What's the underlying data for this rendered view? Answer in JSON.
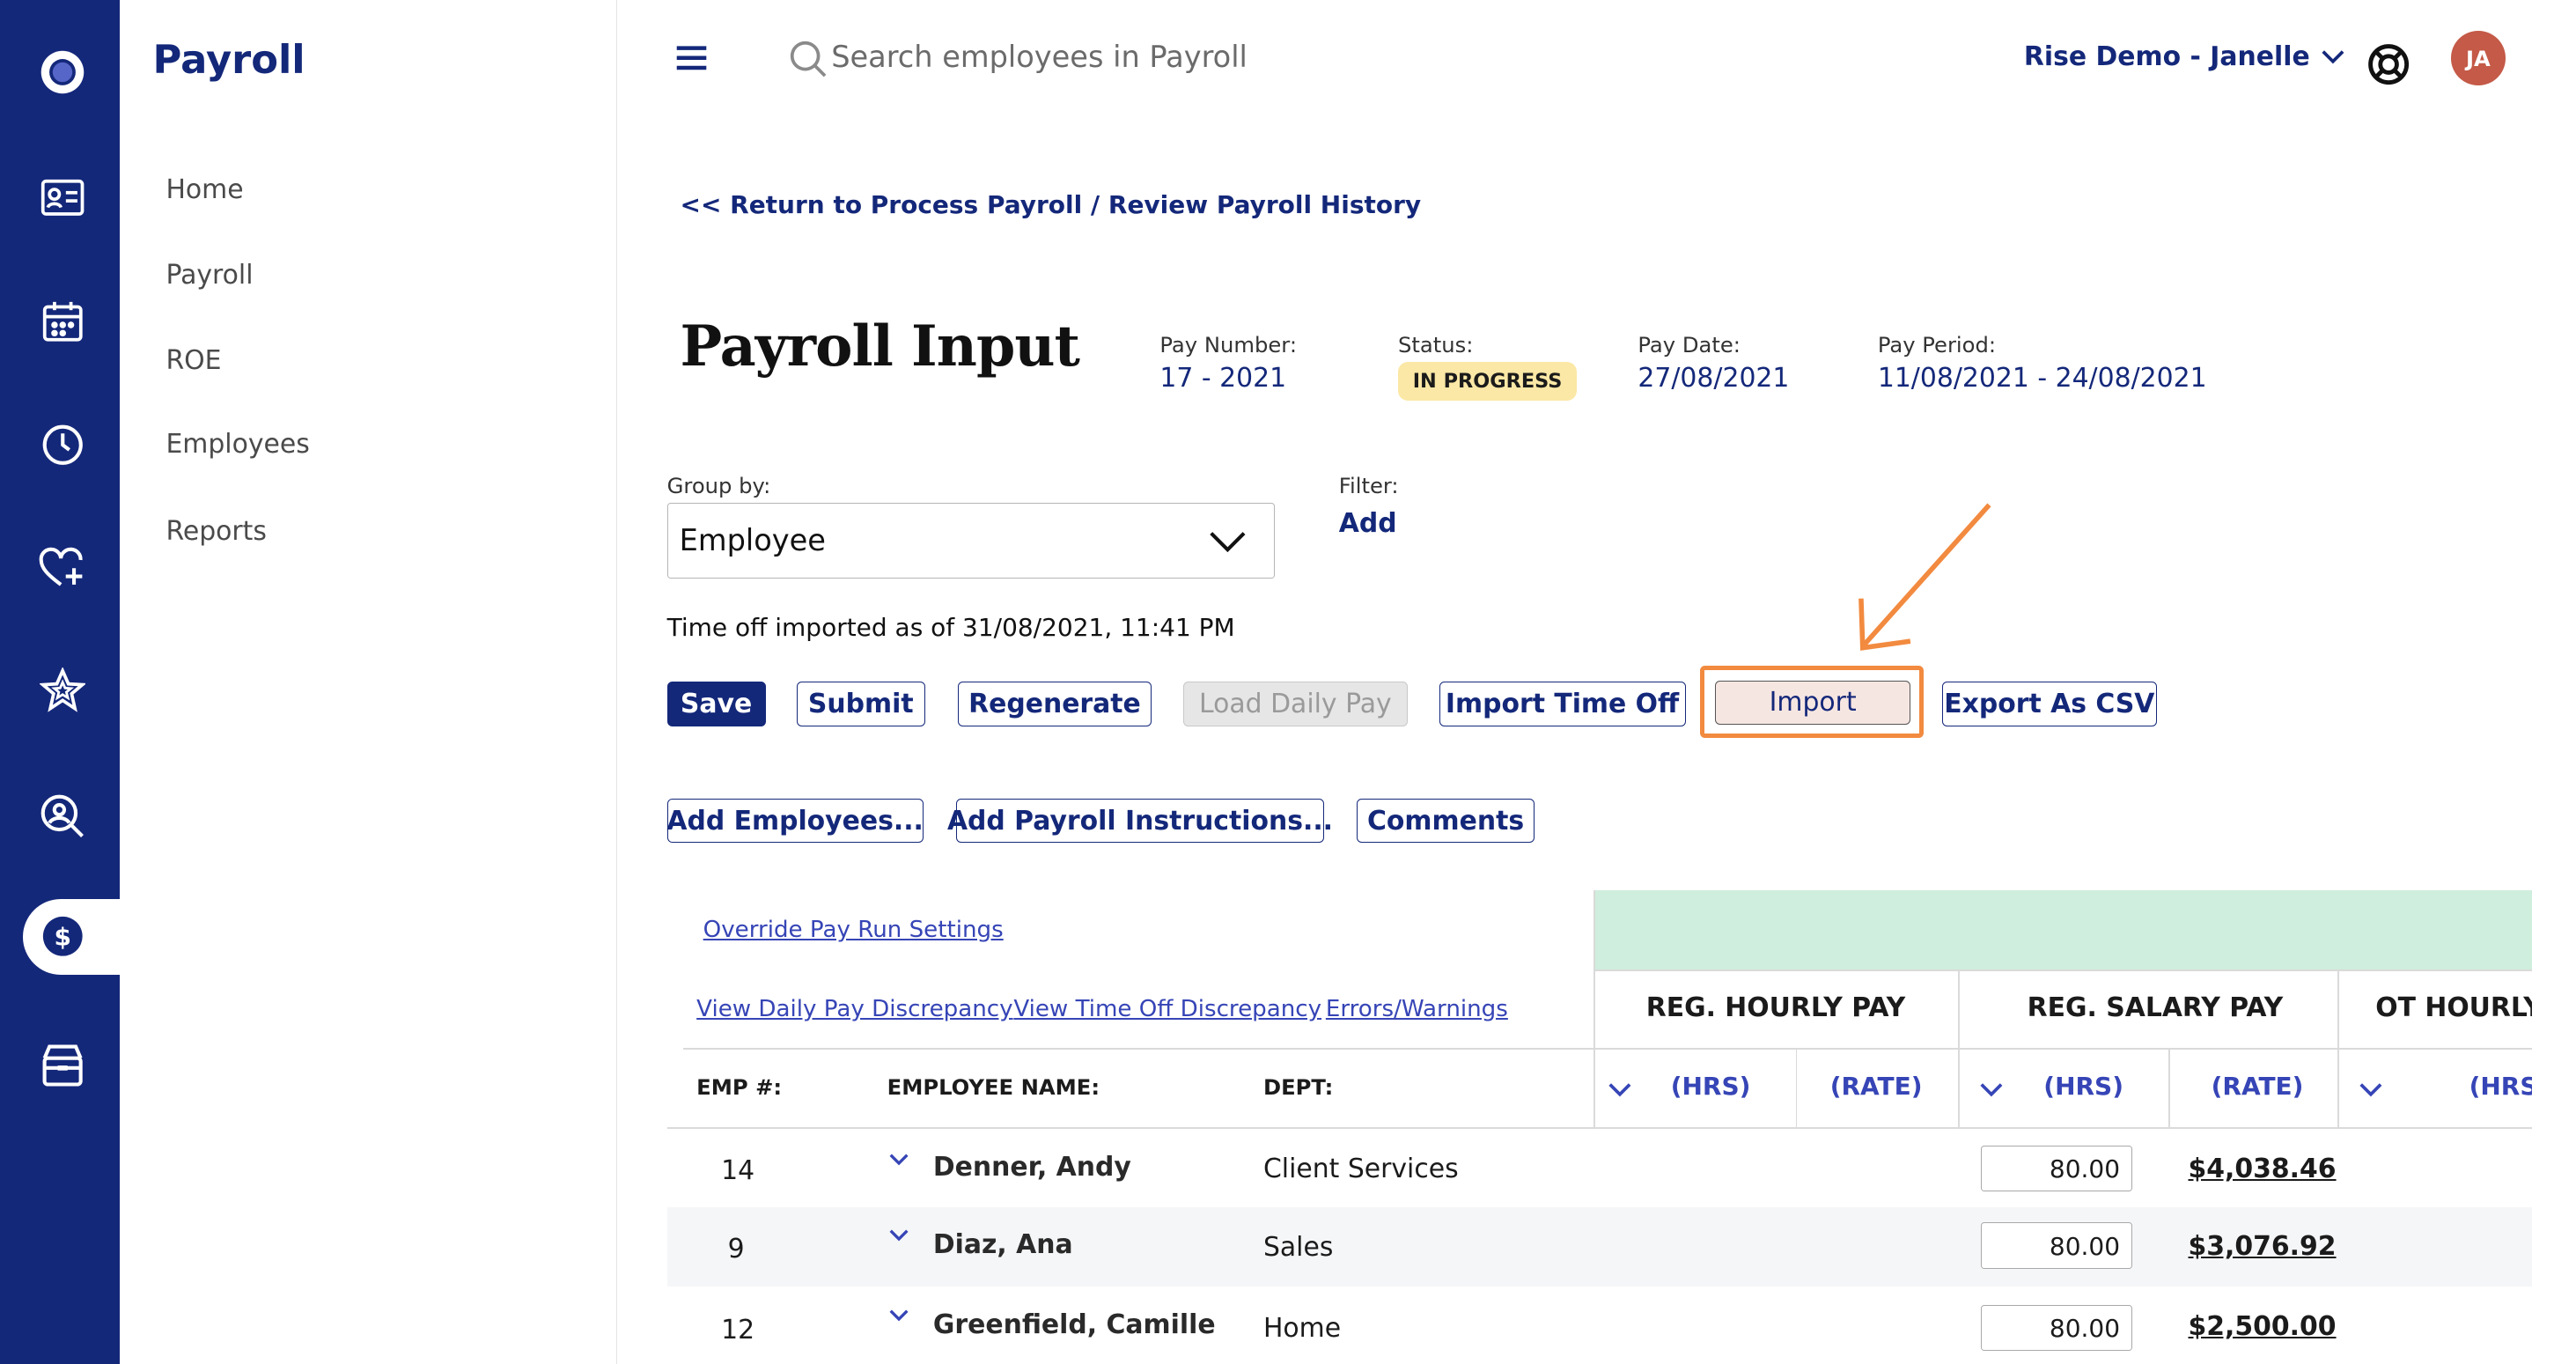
{
  "sidebar": {
    "brand": "Payroll",
    "items": [
      {
        "label": "Home"
      },
      {
        "label": "Payroll"
      },
      {
        "label": "ROE"
      },
      {
        "label": "Employees"
      },
      {
        "label": "Reports"
      }
    ]
  },
  "topbar": {
    "search_placeholder": "Search employees in Payroll",
    "company": "Rise Demo - Janelle",
    "avatar_initials": "JA"
  },
  "breadcrumb": "<< Return to Process Payroll / Review Payroll History",
  "page_title": "Payroll Input",
  "meta": {
    "pay_number_label": "Pay Number:",
    "pay_number": "17 - 2021",
    "status_label": "Status:",
    "status": "IN PROGRESS",
    "pay_date_label": "Pay Date:",
    "pay_date": "27/08/2021",
    "pay_period_label": "Pay Period:",
    "pay_period": "11/08/2021 - 24/08/2021"
  },
  "controls": {
    "group_by_label": "Group by:",
    "group_by_value": "Employee",
    "filter_label": "Filter:",
    "filter_add": "Add",
    "timeoff_note": "Time off imported as of 31/08/2021, 11:41 PM"
  },
  "buttons": {
    "save": "Save",
    "submit": "Submit",
    "regenerate": "Regenerate",
    "load_daily_pay": "Load Daily Pay",
    "import_time_off": "Import Time Off",
    "import": "Import",
    "export_csv": "Export As CSV",
    "add_employees": "Add Employees...",
    "add_payroll_instructions": "Add Payroll Instructions...",
    "comments": "Comments"
  },
  "table": {
    "override_link": "Override Pay Run Settings",
    "links": [
      "View Daily Pay Discrepancy",
      "View Time Off Discrepancy",
      "Errors/Warnings"
    ],
    "col_groups": [
      "REG. HOURLY PAY",
      "REG. SALARY PAY",
      "OT HOURLY"
    ],
    "headers": {
      "emp": "EMP #:",
      "name": "EMPLOYEE NAME:",
      "dept": "DEPT:"
    },
    "sub_hrs": "(HRS)",
    "sub_rate": "(RATE)",
    "rows": [
      {
        "emp": "14",
        "name": "Denner, Andy",
        "dept": "Client Services",
        "salary_hrs": "80.00",
        "salary_rate": "$4,038.46"
      },
      {
        "emp": "9",
        "name": "Diaz, Ana",
        "dept": "Sales",
        "salary_hrs": "80.00",
        "salary_rate": "$3,076.92"
      },
      {
        "emp": "12",
        "name": "Greenfield, Camille",
        "dept": "Home",
        "salary_hrs": "80.00",
        "salary_rate": "$2,500.00"
      }
    ]
  },
  "colors": {
    "brand": "#14287a",
    "highlight": "#f28a3f",
    "badge": "#fbe8a6",
    "green_band": "#cfeedd"
  }
}
